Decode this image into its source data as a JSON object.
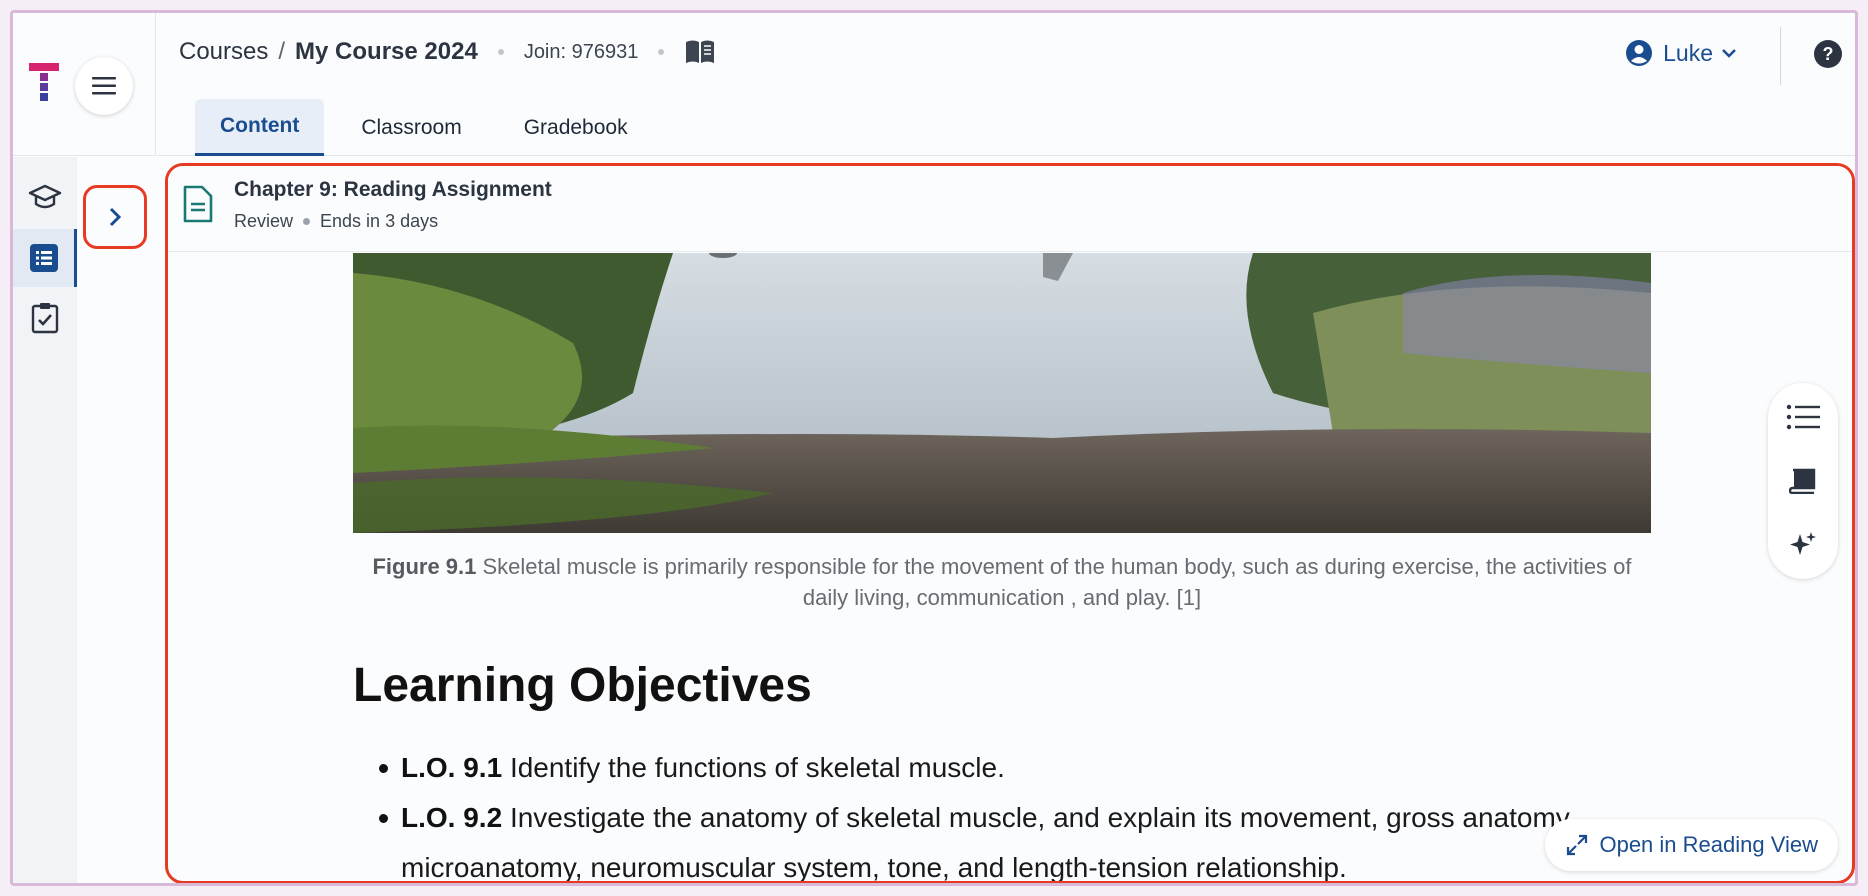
{
  "breadcrumb": {
    "root": "Courses",
    "separator": "/",
    "current": "My Course 2024",
    "join": "Join: 976931"
  },
  "tabs": [
    {
      "label": "Content"
    },
    {
      "label": "Classroom"
    },
    {
      "label": "Gradebook"
    }
  ],
  "user": {
    "name": "Luke"
  },
  "assignment": {
    "title": "Chapter 9: Reading Assignment",
    "status": "Review",
    "due": "Ends in 3 days"
  },
  "figure": {
    "label": "Figure 9.1",
    "caption": "Skeletal muscle is primarily responsible for the movement of the human body, such as during exercise, the activities of daily living, communication , and play. [1]"
  },
  "objectives": {
    "heading": "Learning Objectives",
    "items": [
      {
        "code": "L.O. 9.1",
        "text": "Identify the functions of skeletal muscle."
      },
      {
        "code": "L.O. 9.2",
        "text": "Investigate the anatomy of skeletal muscle, and explain its movement, gross anatomy,",
        "continuation": "microanatomy, neuromuscular system, tone, and length-tension relationship."
      }
    ]
  },
  "reading_view": {
    "label": "Open in Reading View"
  },
  "icons": {
    "logo": "brand-t-logo",
    "menu": "hamburger-icon",
    "book": "book-open-icon",
    "user": "user-circle-icon",
    "help": "help-circle-icon",
    "courses": "graduation-cap-icon",
    "list": "list-icon",
    "tasks": "clipboard-check-icon",
    "expand": "chevron-right-icon",
    "document": "document-icon",
    "toc": "list-lines-icon",
    "notebook": "notebook-icon",
    "ai": "sparkle-icon",
    "expand_view": "expand-arrows-icon"
  },
  "colors": {
    "accent": "#1a4d8f",
    "highlight": "#e63a22",
    "logo_pink": "#d6246e",
    "logo_purple": "#5b3c9e"
  }
}
